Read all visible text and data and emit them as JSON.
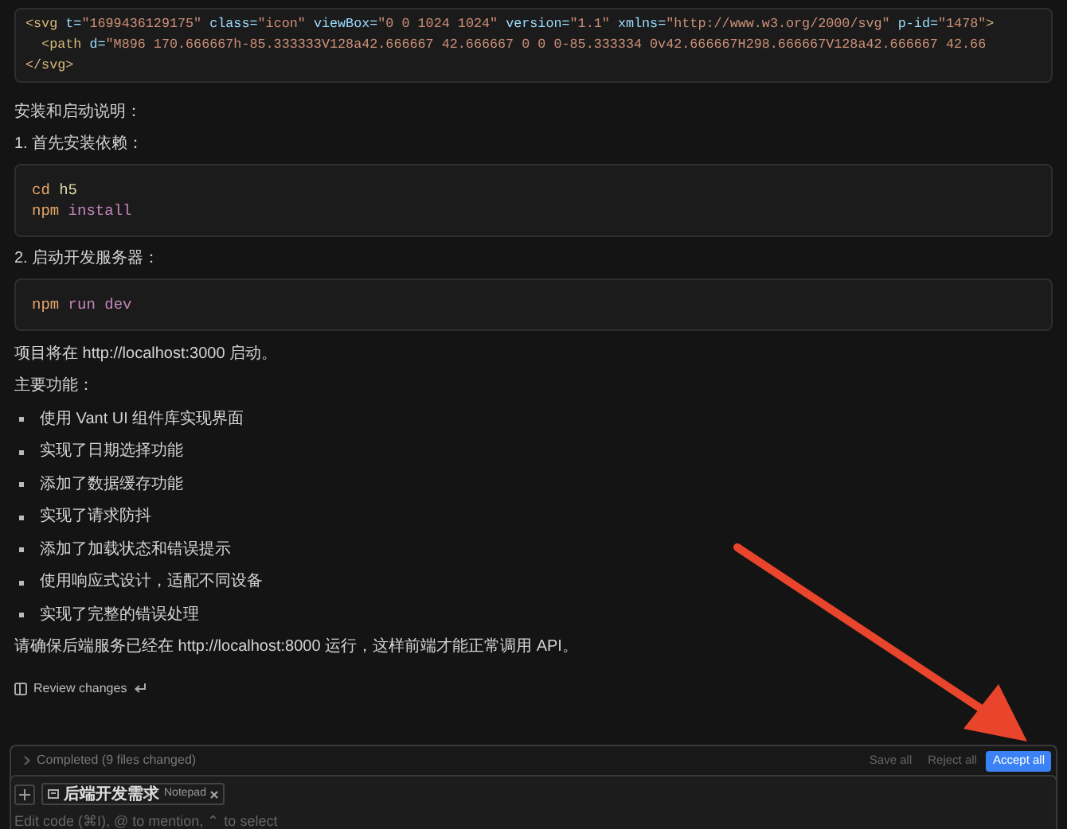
{
  "code_blocks": [
    {
      "lines": [
        [
          {
            "kind": "tag",
            "text": "<svg"
          },
          {
            "kind": "attr",
            "text": " t="
          },
          {
            "kind": "str",
            "text": "\"1699436129175\""
          },
          {
            "kind": "attr",
            "text": " class="
          },
          {
            "kind": "str",
            "text": "\"icon\""
          },
          {
            "kind": "attr",
            "text": " viewBox="
          },
          {
            "kind": "str",
            "text": "\"0 0 1024 1024\""
          },
          {
            "kind": "attr",
            "text": " version="
          },
          {
            "kind": "str",
            "text": "\"1.1\""
          },
          {
            "kind": "attr",
            "text": " xmlns="
          },
          {
            "kind": "str",
            "text": "\"http://www.w3.org/2000/svg\""
          },
          {
            "kind": "attr",
            "text": " p-id="
          },
          {
            "kind": "str",
            "text": "\"1478\""
          },
          {
            "kind": "tag",
            "text": ">"
          }
        ],
        [
          {
            "kind": "tag",
            "text": "  <path"
          },
          {
            "kind": "attr",
            "text": " d="
          },
          {
            "kind": "str",
            "text": "\"M896 170.666667h-85.333333V128a42.666667 42.666667 0 0 0-85.333334 0v42.666667H298.666667V128a42.666667 42.66"
          }
        ],
        [
          {
            "kind": "tag",
            "text": "</svg>"
          }
        ]
      ]
    }
  ],
  "intro": "安装和启动说明：",
  "steps": [
    {
      "heading": "1. 首先安装依赖：",
      "lines": [
        [
          {
            "kind": "cmd",
            "text": "cd"
          },
          {
            "kind": "plain",
            "text": " h5"
          }
        ],
        [
          {
            "kind": "cmd",
            "text": "npm"
          },
          {
            "kind": "arg",
            "text": " install"
          }
        ]
      ]
    },
    {
      "heading": "2. 启动开发服务器：",
      "lines": [
        [
          {
            "kind": "cmd",
            "text": "npm"
          },
          {
            "kind": "arg",
            "text": " run dev"
          }
        ]
      ]
    }
  ],
  "start_note": "项目将在 http://localhost:3000 启动。",
  "features_heading": "主要功能：",
  "features": [
    "使用 Vant UI 组件库实现界面",
    "实现了日期选择功能",
    "添加了数据缓存功能",
    "实现了请求防抖",
    "添加了加载状态和错误提示",
    "使用响应式设计，适配不同设备",
    "实现了完整的错误处理"
  ],
  "backend_note": "请确保后端服务已经在 http://localhost:8000 运行，这样前端才能正常调用 API。",
  "review_link": "Review changes",
  "status_bar": {
    "label": "Completed (9 files changed)",
    "buttons": [
      {
        "label": "Save all",
        "primary": false
      },
      {
        "label": "Reject all",
        "primary": false
      },
      {
        "label": "Accept all",
        "primary": true
      }
    ]
  },
  "composer": {
    "chip": {
      "title": "后端开发需求",
      "type": "Notepad"
    },
    "placeholder": "Edit code (⌘I), @ to mention, ⌃ to select"
  }
}
